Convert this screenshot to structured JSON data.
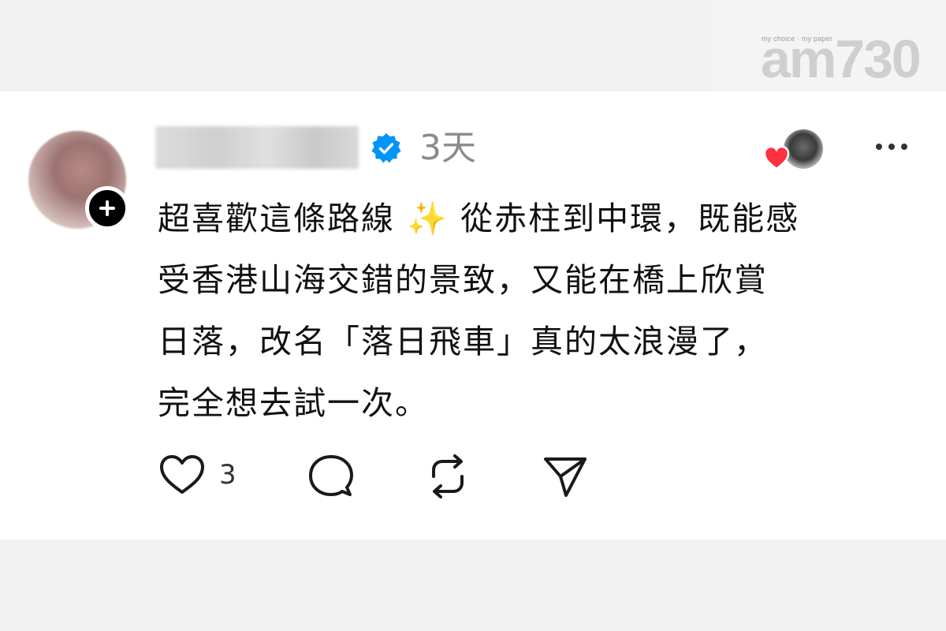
{
  "watermark": {
    "tagline": "my choice · my paper",
    "logo": "am730"
  },
  "post": {
    "username": "",
    "verified": true,
    "time": "3天",
    "lines": [
      "超喜歡這條路線 ✨  從赤柱到中環，既能感",
      "受香港山海交錯的景致，又能在橋上欣賞",
      "日落，改名「落日飛車」真的太浪漫了，",
      "完全想去試一次。"
    ],
    "likes": "3"
  },
  "icons": {
    "follow": "plus-icon",
    "verified": "verified-badge-icon",
    "liker": "heart-icon",
    "more": "more-dots-icon",
    "like": "heart-outline-icon",
    "comment": "comment-icon",
    "repost": "repost-icon",
    "share": "send-icon"
  },
  "colors": {
    "verified": "#0095f6",
    "heart": "#ff3040"
  }
}
